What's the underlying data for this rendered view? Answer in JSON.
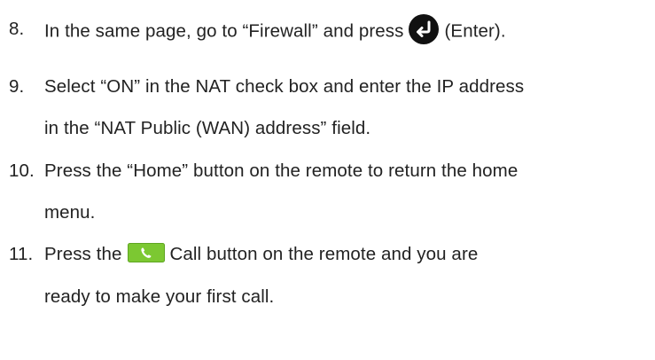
{
  "steps": [
    {
      "number": "8.",
      "text_before": "In the same page, go to “Firewall” and press",
      "icon": "enter-icon",
      "text_after": "(Enter)."
    },
    {
      "number": "9.",
      "line1": "Select “ON” in the NAT check box and enter the IP address",
      "line2": "in the “NAT Public (WAN) address” field."
    },
    {
      "number": "10.",
      "line1": "Press the “Home” button on the remote to return the home",
      "line2": "menu."
    },
    {
      "number": "11.",
      "text_before": "Press the",
      "icon": "phone-call-icon",
      "text_after": "Call button on the remote and you are",
      "line2": "ready to make your first call."
    }
  ],
  "colors": {
    "text": "#222222",
    "enter_icon_fill": "#111111",
    "call_icon_fill": "#7cc832"
  }
}
